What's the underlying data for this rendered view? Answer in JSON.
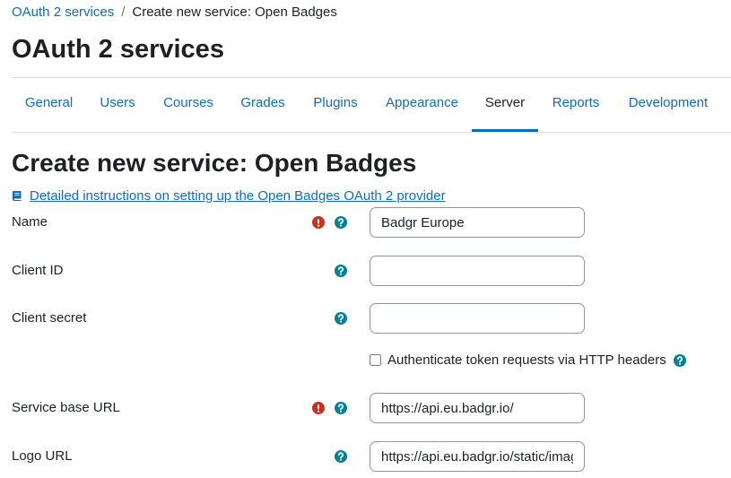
{
  "breadcrumb": {
    "parent": "OAuth 2 services",
    "separator": "/",
    "current": "Create new service: Open Badges"
  },
  "page_title": "OAuth 2 services",
  "tabs": [
    {
      "label": "General",
      "active": false
    },
    {
      "label": "Users",
      "active": false
    },
    {
      "label": "Courses",
      "active": false
    },
    {
      "label": "Grades",
      "active": false
    },
    {
      "label": "Plugins",
      "active": false
    },
    {
      "label": "Appearance",
      "active": false
    },
    {
      "label": "Server",
      "active": true
    },
    {
      "label": "Reports",
      "active": false
    },
    {
      "label": "Development",
      "active": false
    }
  ],
  "section_title": "Create new service: Open Badges",
  "doc_link": {
    "icon": "book-icon",
    "text": "Detailed instructions on setting up the Open Badges OAuth 2 provider"
  },
  "form": {
    "name": {
      "label": "Name",
      "value": "Badgr Europe",
      "required": true
    },
    "client_id": {
      "label": "Client ID",
      "value": "",
      "required": false
    },
    "client_secret": {
      "label": "Client secret",
      "value": "",
      "required": false
    },
    "auth_header": {
      "label": "Authenticate token requests via HTTP headers",
      "checked": false
    },
    "service_base_url": {
      "label": "Service base URL",
      "value": "https://api.eu.badgr.io/",
      "required": true
    },
    "logo_url": {
      "label": "Logo URL",
      "value": "https://api.eu.badgr.io/static/images/",
      "required": false
    }
  },
  "colors": {
    "link": "#0f6cbf",
    "required": "#ca3120",
    "help": "#008196",
    "text": "#1d2125"
  }
}
